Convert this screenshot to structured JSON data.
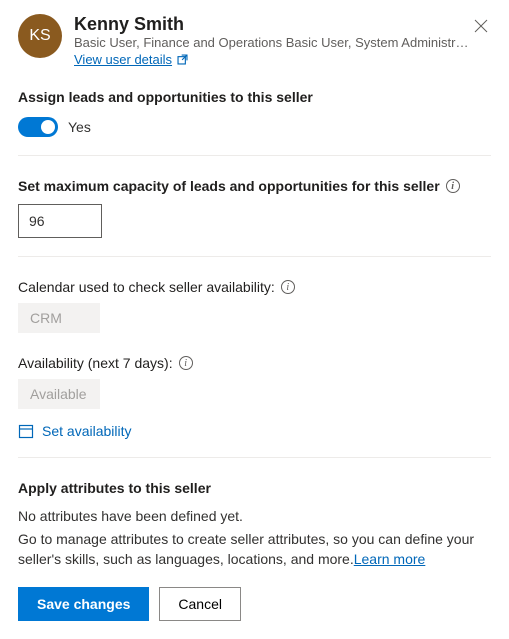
{
  "header": {
    "initials": "KS",
    "name": "Kenny Smith",
    "roles": "Basic User, Finance and Operations Basic User, System Administr…",
    "view_details": "View user details"
  },
  "assign": {
    "label": "Assign leads and opportunities to this seller",
    "toggle_text": "Yes"
  },
  "capacity": {
    "label": "Set maximum capacity of leads and opportunities for this seller",
    "value": "96"
  },
  "calendar": {
    "label": "Calendar used to check seller availability:",
    "value": "CRM"
  },
  "availability": {
    "label": "Availability (next 7 days):",
    "value": "Available",
    "set_link": "Set availability"
  },
  "attributes": {
    "label": "Apply attributes to this seller",
    "none_text": "No attributes have been defined yet.",
    "help_text": "Go to manage attributes to create seller attributes, so you can define your seller's skills, such as languages, locations, and more.",
    "learn_more": "Learn more"
  },
  "footer": {
    "save": "Save changes",
    "cancel": "Cancel"
  }
}
